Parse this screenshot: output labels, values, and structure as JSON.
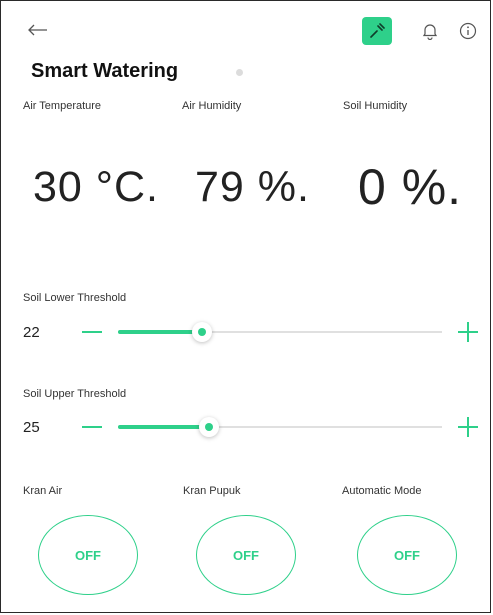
{
  "header": {
    "title": "Smart Watering",
    "icons": {
      "back": "arrow-left-icon",
      "tools": "wrench-icon",
      "bell": "bell-icon",
      "info": "info-icon"
    },
    "accent": "#2ed08a"
  },
  "stats": [
    {
      "label": "Air Temperature",
      "value": "30 °C."
    },
    {
      "label": "Air Humidity",
      "value": "79 %."
    },
    {
      "label": "Soil Humidity",
      "value": "0 %."
    }
  ],
  "thresholds": {
    "lower": {
      "label": "Soil Lower Threshold",
      "value": "22",
      "level": 0.26
    },
    "upper": {
      "label": "Soil Upper Threshold",
      "value": "25",
      "level": 0.28
    }
  },
  "switches": [
    {
      "label": "Kran Air",
      "state": "OFF"
    },
    {
      "label": "Kran Pupuk",
      "state": "OFF"
    },
    {
      "label": "Automatic Mode",
      "state": "OFF"
    }
  ]
}
